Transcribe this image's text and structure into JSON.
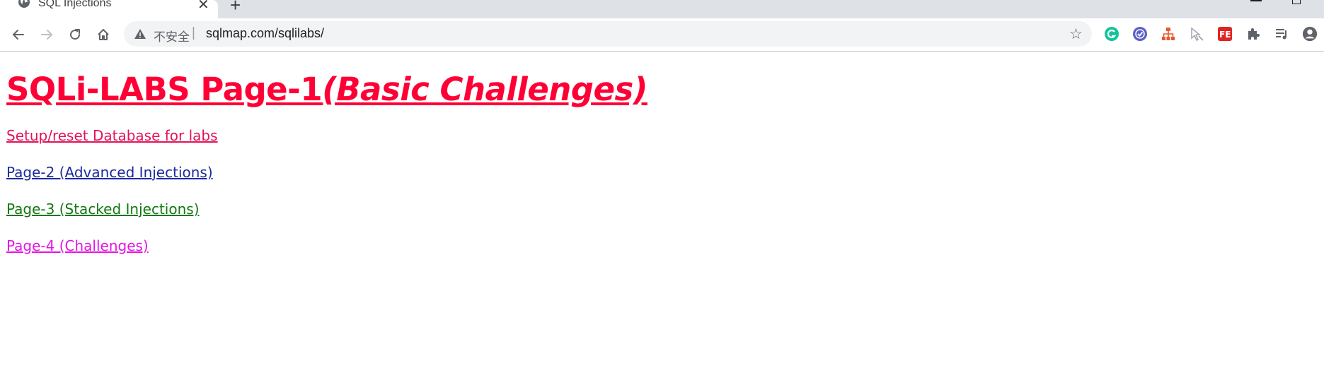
{
  "browser": {
    "tab": {
      "title": "SQL Injections",
      "close_label": "✕",
      "favicon": "globe-icon"
    },
    "new_tab_label": "+",
    "omnibox": {
      "insecure_label": "不安全",
      "separator": "|",
      "url": "sqlmap.com/sqlilabs/",
      "warning_icon": "warning-icon"
    },
    "star_label": "☆",
    "extensions": [
      "grammarly-icon",
      "check-circle-icon",
      "sitemap-icon",
      "cursor-block-icon",
      "fe-extension-icon",
      "puzzle-icon",
      "reading-list-icon",
      "profile-icon"
    ],
    "colors": {
      "tabstrip": "#dee1e6",
      "omnibox": "#f1f3f4"
    }
  },
  "page": {
    "heading": {
      "main": "SQLi-LABS Page-1",
      "sub": "(Basic Challenges)"
    },
    "links": {
      "setup": "Setup/reset Database for labs",
      "page2": "Page-2 (Advanced Injections)",
      "page3": "Page-3 (Stacked Injections)",
      "page4": "Page-4 (Challenges)"
    },
    "colors": {
      "heading": "#ff0036",
      "setup": "#e2135a",
      "page2": "#1b2b9c",
      "page3": "#117811",
      "page4": "#e414e4"
    }
  }
}
